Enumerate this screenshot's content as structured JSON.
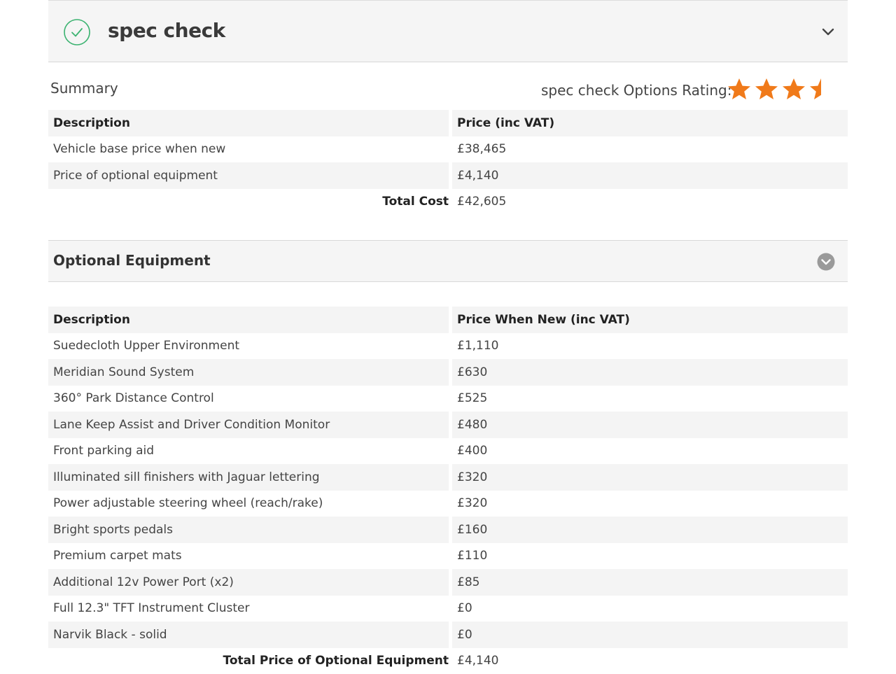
{
  "spec_header": {
    "title": "spec check",
    "check_icon": "check-circle-icon",
    "collapse_icon": "chevron-down-icon",
    "accent_color": "#3cb371"
  },
  "summary": {
    "label": "Summary",
    "rating_label": "spec check Options Rating:",
    "rating_stars": 3.5,
    "rating_max": 5,
    "star_color": "#f07a1a"
  },
  "summary_table": {
    "headers": [
      "Description",
      "Price (inc VAT)"
    ],
    "rows": [
      [
        "Vehicle base price when new",
        "£38,465"
      ],
      [
        "Price of optional equipment",
        "£4,140"
      ]
    ],
    "total_label": "Total Cost",
    "total_value": "£42,605"
  },
  "optional_equipment": {
    "title": "Optional Equipment",
    "toggle_icon": "chevron-down-circle-icon",
    "headers": [
      "Description",
      "Price When New (inc VAT)"
    ],
    "rows": [
      [
        "Suedecloth Upper Environment",
        "£1,110"
      ],
      [
        "Meridian Sound System",
        "£630"
      ],
      [
        "360° Park Distance Control",
        "£525"
      ],
      [
        "Lane Keep Assist and Driver Condition Monitor",
        "£480"
      ],
      [
        "Front parking aid",
        "£400"
      ],
      [
        "Illuminated sill finishers with Jaguar lettering",
        "£320"
      ],
      [
        "Power adjustable steering wheel (reach/rake)",
        "£320"
      ],
      [
        "Bright sports pedals",
        "£160"
      ],
      [
        "Premium carpet mats",
        "£110"
      ],
      [
        "Additional 12v Power Port (x2)",
        "£85"
      ],
      [
        "Full 12.3\" TFT Instrument Cluster",
        "£0"
      ],
      [
        "Narvik Black - solid",
        "£0"
      ]
    ],
    "total_label": "Total Price of Optional Equipment",
    "total_value": "£4,140"
  }
}
